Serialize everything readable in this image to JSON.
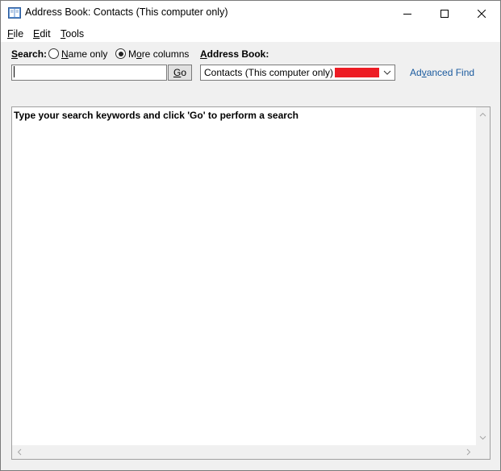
{
  "window": {
    "title": "Address Book: Contacts (This computer only)"
  },
  "menu": {
    "file": {
      "hot": "F",
      "rest": "ile"
    },
    "edit": {
      "hot": "E",
      "rest": "dit"
    },
    "tools": {
      "hot": "T",
      "rest": "ools"
    }
  },
  "search": {
    "label_hot": "S",
    "label_rest": "earch:",
    "value": "",
    "name_only": {
      "hot": "N",
      "rest": "ame only",
      "checked": false
    },
    "more_columns": {
      "pre": "M",
      "hot": "o",
      "rest": "re columns",
      "checked": true
    },
    "go": {
      "hot": "G",
      "rest": "o"
    }
  },
  "address_book": {
    "label_pre": "",
    "label_hot": "A",
    "label_rest": "ddress Book:",
    "selected": "Contacts (This computer only) -"
  },
  "advanced_find": {
    "pre": "Ad",
    "hot": "v",
    "rest": "anced Find"
  },
  "results": {
    "message": "Type your search keywords and click 'Go' to perform a search"
  },
  "colors": {
    "redaction": "#ed1c24",
    "link": "#1a5a9e"
  }
}
